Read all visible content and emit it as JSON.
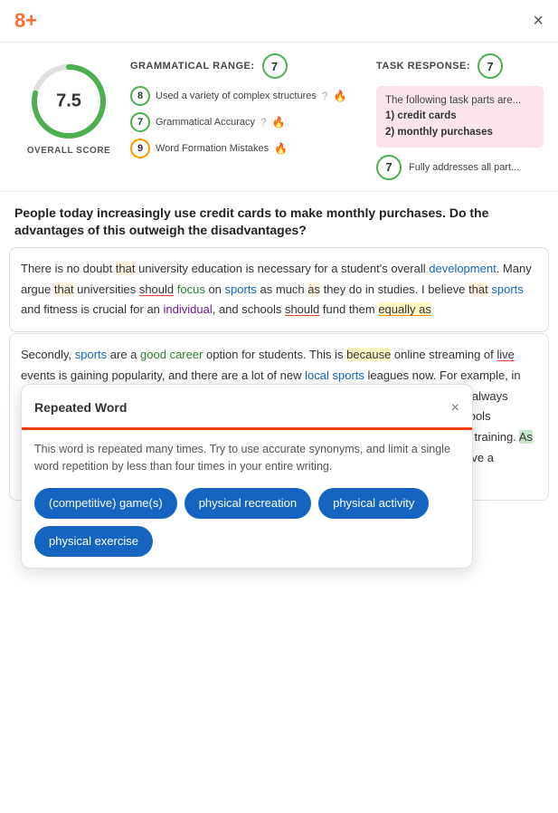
{
  "header": {
    "logo": "8+",
    "close_label": "×"
  },
  "scores": {
    "overall": "7.5",
    "overall_label": "OVERALL SCORE",
    "grammatical_range_label": "GRAMMATICAL RANGE:",
    "grammatical_range_score": "7",
    "task_response_label": "TASK RESPONSE:",
    "task_response_score": "7",
    "details": [
      {
        "score": "8",
        "text": "Used a variety of complex structures",
        "icon": "question",
        "icon2": "flame-orange"
      },
      {
        "score": "7",
        "text": "Grammatical Accuracy",
        "icon": "question",
        "icon2": "flame-orange"
      },
      {
        "score": "9",
        "text": "Word Formation Mistakes",
        "icon2": "flame-red"
      }
    ],
    "task_response_box": {
      "intro": "The following task parts are...",
      "items": [
        "1) credit cards",
        "2) monthly purchases"
      ]
    },
    "task_fully": "Fully addresses all part..."
  },
  "essay": {
    "prompt": "People today increasingly use credit cards to make monthly purchases. Do the advantages of this outweigh the disadvantages?",
    "paragraphs": [
      "There is no doubt that university education is necessary for a student's overall development. Many argue that universities should focus on sports as much as they do in studies. I believe that sports and fitness is crucial for an individual, and schools should fund them equally as",
      "Secondly, sports are a good career option for students. This is because online streaming of live events is gaining popularity, and there are a lot of new local sports leagues now. For example, in India, within the last five years, many different types of sports league started. They are always looking to recruit young talent, and their main priority is the local universities. If the schools increase their spending on sports, more and more individuals will get a better quality of training. As a result, they can compete at an international level. To conclude, universities should have a balanced approach towards a student's learning."
    ]
  },
  "popup": {
    "title": "Repeated Word",
    "close_label": "×",
    "description": "This word is repeated many times. Try to use accurate synonyms, and limit a single word repetition by less than four times in your entire writing.",
    "tags": [
      "(competitive) game(s)",
      "physical recreation",
      "physical activity",
      "physical exercise"
    ]
  }
}
